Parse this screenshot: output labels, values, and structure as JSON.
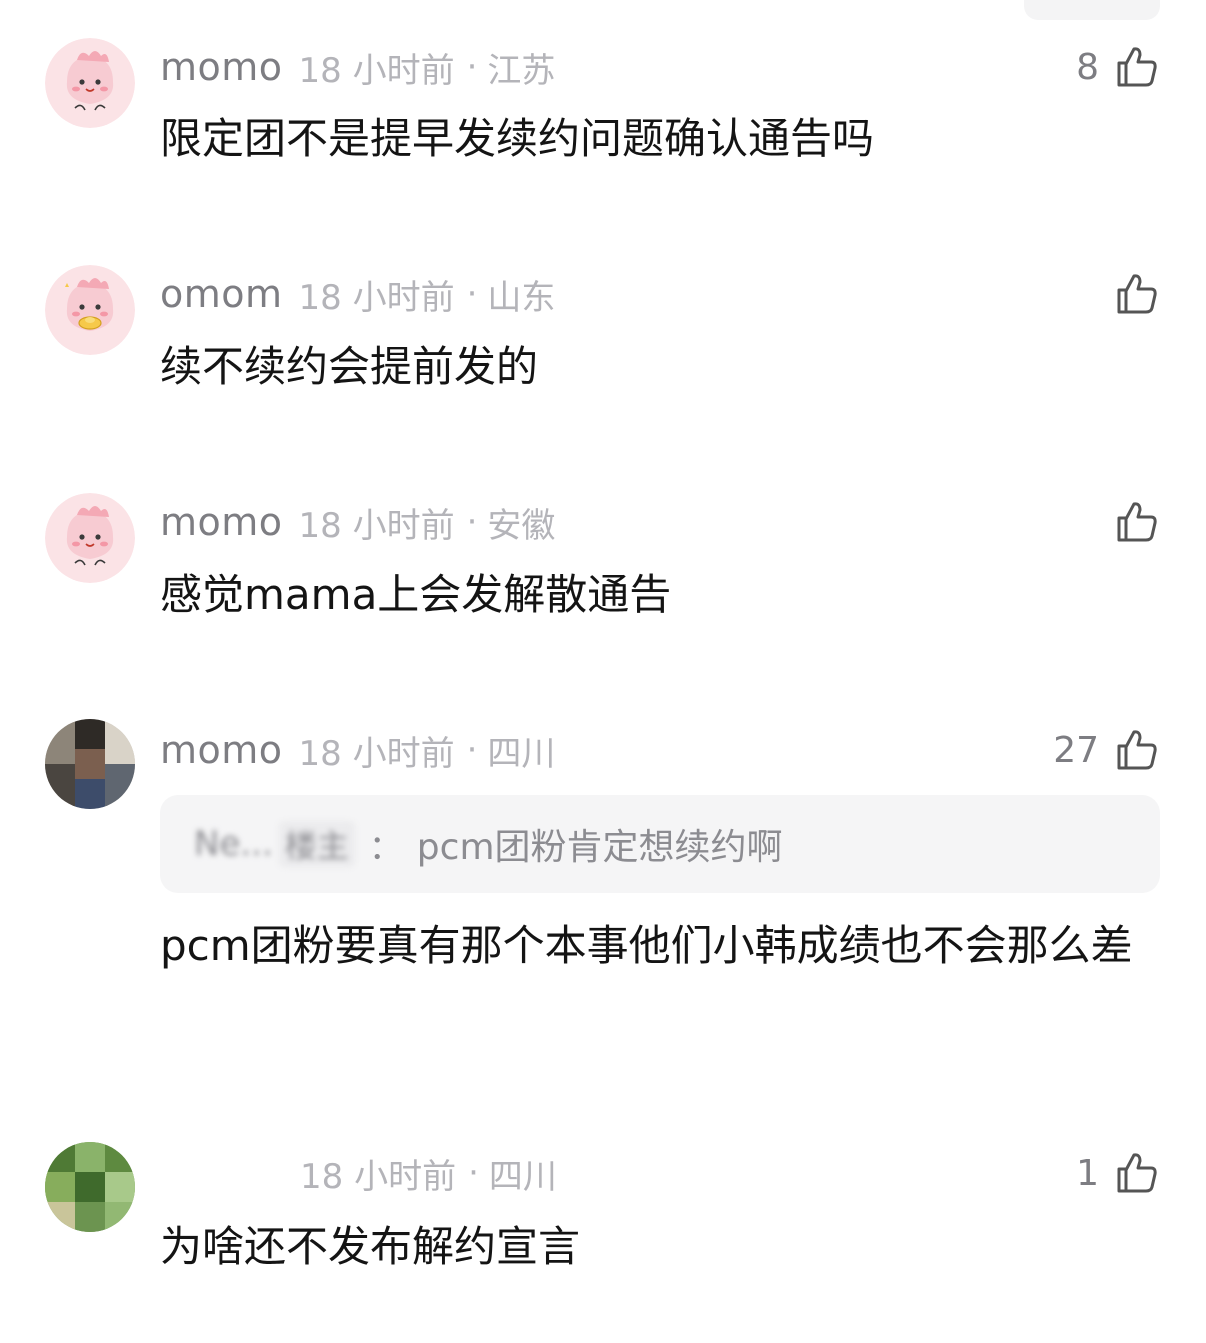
{
  "colors": {
    "username": "#7d7d82",
    "meta": "#b4b4b9",
    "text": "#141414",
    "quote_bg": "#f5f5f6",
    "avatar_pink": "#f6c9cf"
  },
  "comments": [
    {
      "user": "momo",
      "time": "18 小时前",
      "separator": "·",
      "region": "江苏",
      "likes": "8",
      "text": "限定团不是提早发续约问题确认通告吗",
      "avatar_icon": "pink-cartoon-avatar"
    },
    {
      "user": "omom",
      "time": "18 小时前",
      "separator": "·",
      "region": "山东",
      "likes": "",
      "text": "续不续约会提前发的",
      "avatar_icon": "pink-cartoon-gold-avatar"
    },
    {
      "user": "momo",
      "time": "18 小时前",
      "separator": "·",
      "region": "安徽",
      "likes": "",
      "text": "感觉mama上会发解散通告",
      "avatar_icon": "pink-cartoon-avatar"
    },
    {
      "user": "momo",
      "time": "18 小时前",
      "separator": "·",
      "region": "四川",
      "likes": "27",
      "quote": {
        "name": "Ne...",
        "tag": "楼主",
        "colon": "：",
        "text": "pcm团粉肯定想续约啊"
      },
      "text": "pcm团粉要真有那个本事他们小韩成绩也不会那么差",
      "avatar_icon": "photo-avatar-pixelated"
    },
    {
      "user": "",
      "time": "18 小时前",
      "separator": "·",
      "region": "四川",
      "likes": "1",
      "text": "为啥还不发布解约宣言",
      "avatar_icon": "green-photo-avatar-pixelated"
    }
  ]
}
